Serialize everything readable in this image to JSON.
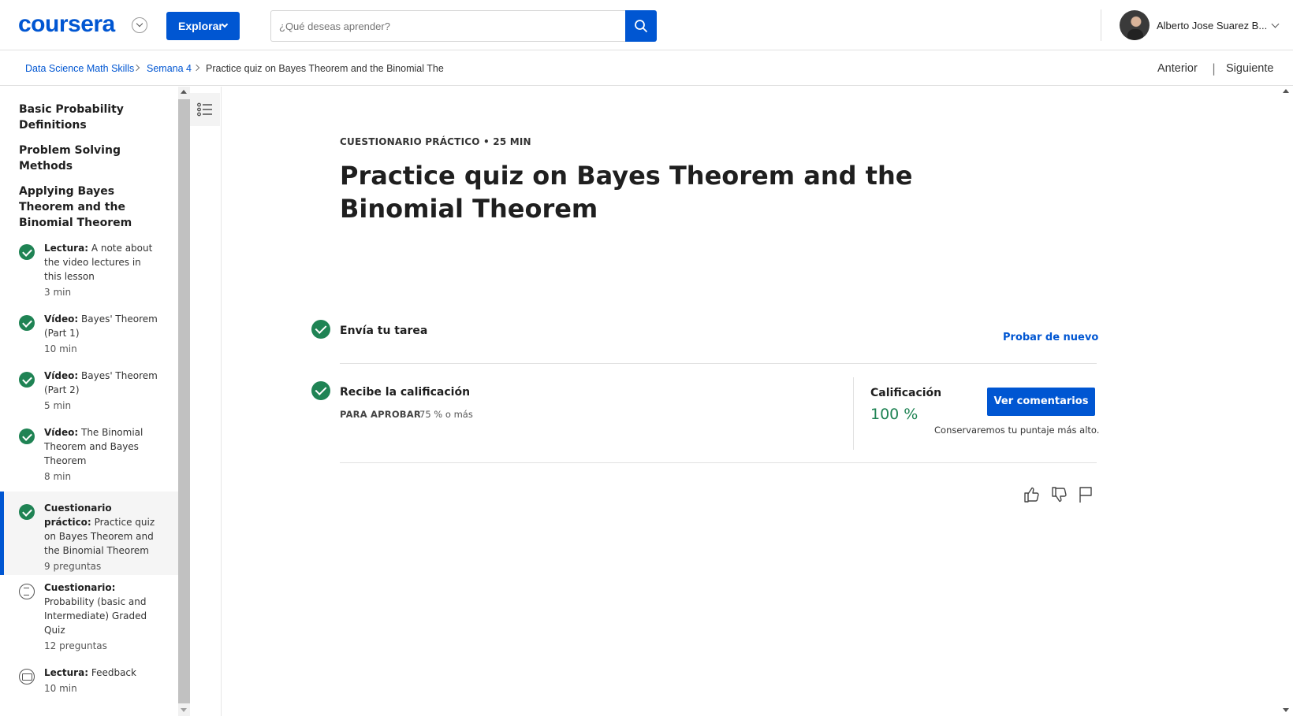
{
  "header": {
    "logo": "coursera",
    "explore_label": "Explorar",
    "search_placeholder": "¿Qué deseas aprender?",
    "user_name": "Alberto Jose Suarez B..."
  },
  "breadcrumb": {
    "items": [
      "Data Science Math Skills",
      "Semana 4",
      "Practice quiz on Bayes Theorem and the Binomial The"
    ],
    "prev_label": "Anterior",
    "next_label": "Siguiente"
  },
  "sidebar": {
    "lessons": [
      "Basic Probability Definitions",
      "Problem Solving Methods",
      "Applying Bayes Theorem and the Binomial Theorem"
    ],
    "items": [
      {
        "type": "Lectura:",
        "title": "A note about the video lectures in this lesson",
        "meta": "3 min",
        "status": "done"
      },
      {
        "type": "Vídeo:",
        "title": "Bayes' Theorem (Part 1)",
        "meta": "10 min",
        "status": "done"
      },
      {
        "type": "Vídeo:",
        "title": "Bayes' Theorem (Part 2)",
        "meta": "5 min",
        "status": "done"
      },
      {
        "type": "Vídeo:",
        "title": "The Binomial Theorem and Bayes Theorem",
        "meta": "8 min",
        "status": "done"
      },
      {
        "type": "Cuestionario práctico:",
        "title": "Practice quiz on Bayes Theorem and the Binomial Theorem",
        "meta": "9 preguntas",
        "status": "done-active"
      },
      {
        "type": "Cuestionario:",
        "title": "Probability (basic and Intermediate) Graded Quiz",
        "meta": "12 preguntas",
        "status": "quiz"
      },
      {
        "type": "Lectura:",
        "title": "Feedback",
        "meta": "10 min",
        "status": "reading"
      }
    ]
  },
  "main": {
    "kicker": "CUESTIONARIO PRÁCTICO • 25 MIN",
    "title": "Practice quiz on Bayes Theorem and the Binomial Theorem",
    "step1_title": "Envía tu tarea",
    "retry_label": "Probar de nuevo",
    "step2_title": "Recibe la calificación",
    "pass_label": "PARA APROBAR",
    "pass_value": "75 % o más",
    "grade_label": "Calificación",
    "grade_value": "100 %",
    "view_feedback_label": "Ver comentarios",
    "keep_note": "Conservaremos tu puntaje más alto."
  },
  "colors": {
    "brand": "#0056d2",
    "success": "#1f8354"
  }
}
